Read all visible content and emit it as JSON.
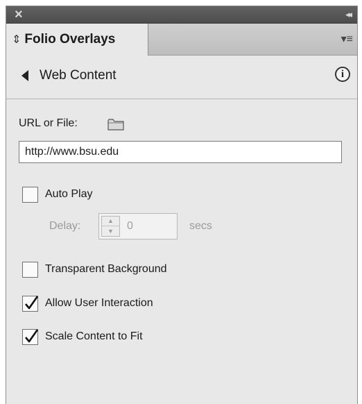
{
  "panel": {
    "tab_label": "Folio Overlays"
  },
  "header": {
    "title": "Web Content"
  },
  "url": {
    "label": "URL or File:",
    "value": "http://www.bsu.edu"
  },
  "auto_play": {
    "label": "Auto Play",
    "checked": false
  },
  "delay": {
    "label": "Delay:",
    "value": "0",
    "unit": "secs"
  },
  "transparent_background": {
    "label": "Transparent Background",
    "checked": false
  },
  "allow_user_interaction": {
    "label": "Allow User Interaction",
    "checked": true
  },
  "scale_content_to_fit": {
    "label": "Scale Content to Fit",
    "checked": true
  },
  "icons": {
    "close": "close-icon",
    "collapse": "double-chevron-right-icon",
    "tab_updown": "up-down-arrows-icon",
    "panel_menu": "panel-menu-icon",
    "back": "back-triangle-icon",
    "info": "info-icon",
    "folder": "folder-icon",
    "checkmark": "checkmark-icon"
  },
  "colors": {
    "titlebar": "#555555",
    "panel_bg": "#e8e8e8",
    "disabled_text": "#9a9a9a"
  }
}
